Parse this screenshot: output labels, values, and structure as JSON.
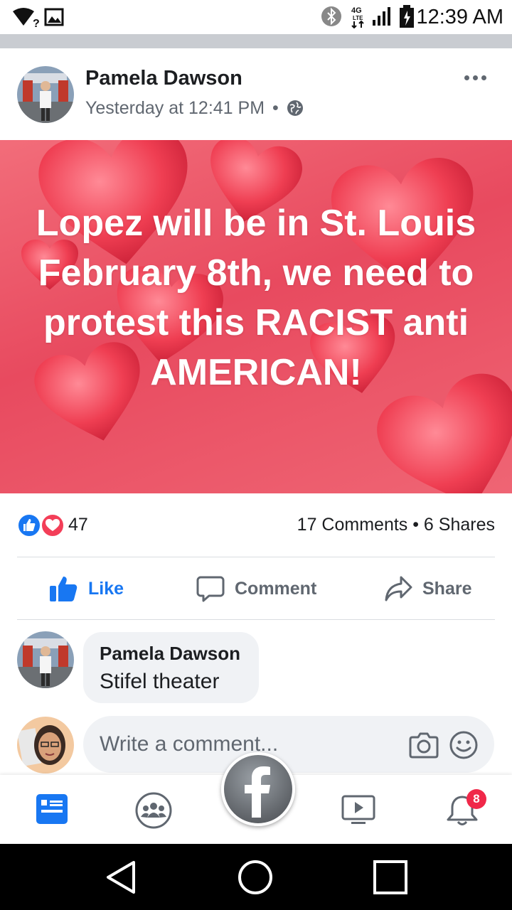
{
  "status_bar": {
    "time": "12:39 AM",
    "network": "4G LTE"
  },
  "post": {
    "author": "Pamela Dawson",
    "time": "Yesterday at 12:41 PM",
    "separator": "•",
    "image_text": "Lopez will be in St. Louis February 8th, we need to protest this RACIST anti AMERICAN!",
    "reaction_count": "47",
    "comments_shares": "17 Comments • 6 Shares"
  },
  "actions": {
    "like": "Like",
    "comment": "Comment",
    "share": "Share"
  },
  "comment": {
    "author": "Pamela Dawson",
    "text": "Stifel theater"
  },
  "composer": {
    "placeholder": "Write a comment..."
  },
  "nav": {
    "notification_count": "8"
  },
  "colors": {
    "facebook_blue": "#1877f2",
    "reaction_red": "#f33e58",
    "post_background": "#e84a5f"
  }
}
